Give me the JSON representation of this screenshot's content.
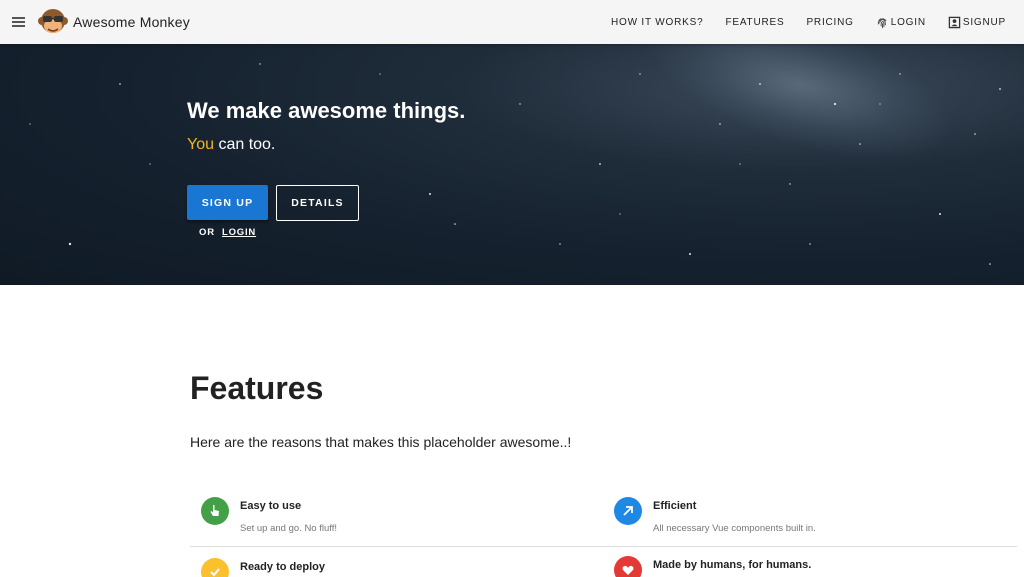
{
  "app": {
    "brand": "Awesome Monkey"
  },
  "nav": {
    "how_it_works": "HOW IT WORKS?",
    "features": "FEATURES",
    "pricing": "PRICING",
    "login": "LOGIN",
    "signup": "SIGNUP"
  },
  "hero": {
    "title": "We make awesome things.",
    "subtitle_accent": "You",
    "subtitle_rest": " can too.",
    "signup_button": "SIGN UP",
    "details_button": "DETAILS",
    "or_text": "OR",
    "login_link": "LOGIN"
  },
  "features": {
    "title": "Features",
    "description": "Here are the reasons that makes this placeholder awesome..!",
    "items": [
      {
        "title": "Easy to use",
        "description": "Set up and go. No fluff!",
        "icon": "pointer-hand-icon",
        "color": "#43a047"
      },
      {
        "title": "Efficient",
        "description": "All necessary Vue components built in.",
        "icon": "arrow-up-right-icon",
        "color": "#1e88e5"
      },
      {
        "title": "Ready to deploy",
        "description": "",
        "icon": "check-cloud-icon",
        "color": "#fbc02d"
      },
      {
        "title": "Made by humans, for humans.",
        "description": "",
        "icon": "heart-icon",
        "color": "#e53935"
      }
    ]
  },
  "colors": {
    "primary": "#1976d2",
    "accent": "#f2b51f",
    "topbar": "#f5f5f5"
  }
}
